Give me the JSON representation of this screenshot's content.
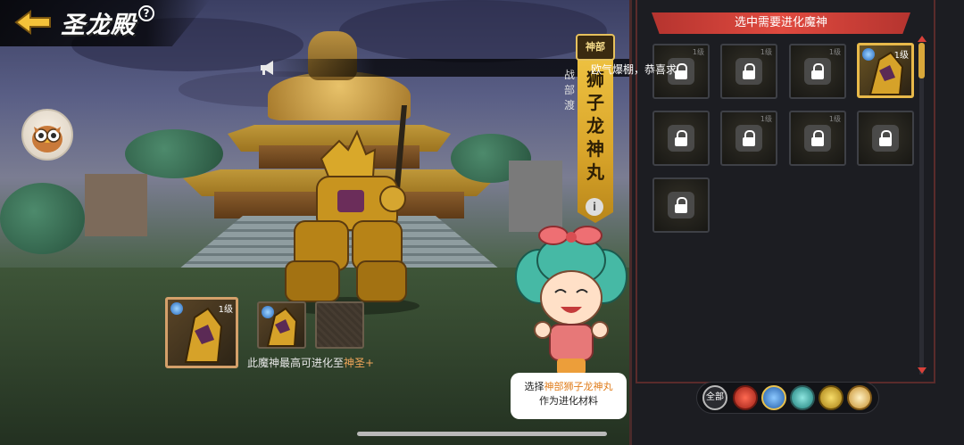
{
  "header": {
    "title": "圣龙殿",
    "help": "?"
  },
  "announcement": {
    "text": "欧气爆棚，恭喜求"
  },
  "banner": {
    "badge": "神部",
    "affiliation": "战部渡",
    "name": "狮子龙神丸",
    "info": "i"
  },
  "materials": {
    "main_level": "1级",
    "hint_prefix": "此魔神最高可进化至",
    "hint_target": "神圣+"
  },
  "speech": {
    "prefix": "选择",
    "highlight": "神部狮子龙神丸",
    "line2": "作为进化材料"
  },
  "panel": {
    "title": "选中需要进化魔神",
    "selected_level": "1级",
    "cells": [
      {
        "level": "1级",
        "locked": true
      },
      {
        "level": "1级",
        "locked": true
      },
      {
        "level": "1级",
        "locked": true
      },
      {
        "level": "1级",
        "locked": false,
        "selected": true
      },
      {
        "level": "",
        "locked": true
      },
      {
        "level": "1级",
        "locked": true
      },
      {
        "level": "1级",
        "locked": true
      },
      {
        "level": "",
        "locked": true
      },
      {
        "level": "",
        "locked": true
      }
    ]
  },
  "filters": {
    "all_label": "全部",
    "icons": [
      "fire-element-icon",
      "water-element-icon",
      "wind-element-icon",
      "thunder-element-icon",
      "light-element-icon"
    ]
  },
  "colors": {
    "accent_red": "#e04a3f",
    "gold": "#e8b94a",
    "highlight_orange": "#f0a65a"
  }
}
